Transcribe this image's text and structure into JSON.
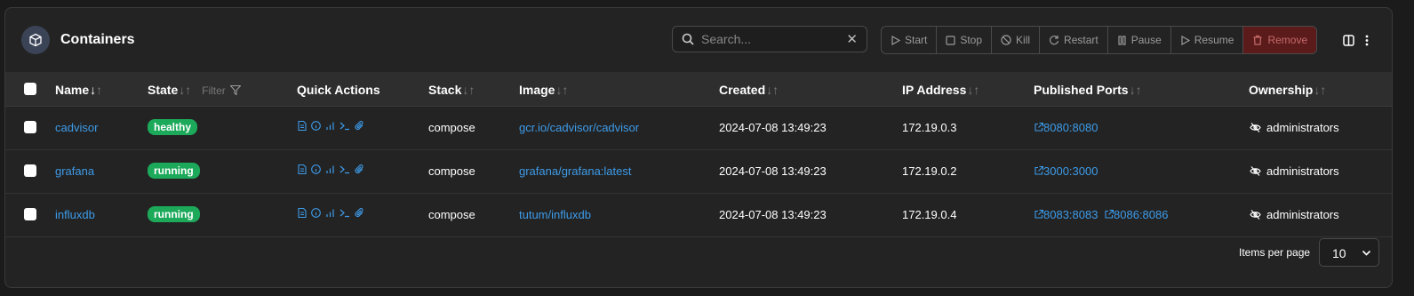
{
  "header": {
    "title": "Containers",
    "search_placeholder": "Search...",
    "actions": {
      "start": "Start",
      "stop": "Stop",
      "kill": "Kill",
      "restart": "Restart",
      "pause": "Pause",
      "resume": "Resume",
      "remove": "Remove"
    }
  },
  "columns": {
    "name": "Name",
    "state": "State",
    "state_filter": "Filter",
    "quick_actions": "Quick Actions",
    "stack": "Stack",
    "image": "Image",
    "created": "Created",
    "ip_address": "IP Address",
    "published_ports": "Published Ports",
    "ownership": "Ownership"
  },
  "rows": [
    {
      "name": "cadvisor",
      "state": "healthy",
      "stack": "compose",
      "image": "gcr.io/cadvisor/cadvisor",
      "created": "2024-07-08 13:49:23",
      "ip": "172.19.0.3",
      "ports": [
        "8080:8080"
      ],
      "ownership": "administrators"
    },
    {
      "name": "grafana",
      "state": "running",
      "stack": "compose",
      "image": "grafana/grafana:latest",
      "created": "2024-07-08 13:49:23",
      "ip": "172.19.0.2",
      "ports": [
        "3000:3000"
      ],
      "ownership": "administrators"
    },
    {
      "name": "influxdb",
      "state": "running",
      "stack": "compose",
      "image": "tutum/influxdb",
      "created": "2024-07-08 13:49:23",
      "ip": "172.19.0.4",
      "ports": [
        "8083:8083",
        "8086:8086"
      ],
      "ownership": "administrators"
    }
  ],
  "footer": {
    "items_per_page_label": "Items per page",
    "items_per_page_value": "10"
  },
  "colors": {
    "accent": "#3d9be9",
    "healthy": "#1ca95a",
    "remove_bg": "#5c1b1b"
  }
}
